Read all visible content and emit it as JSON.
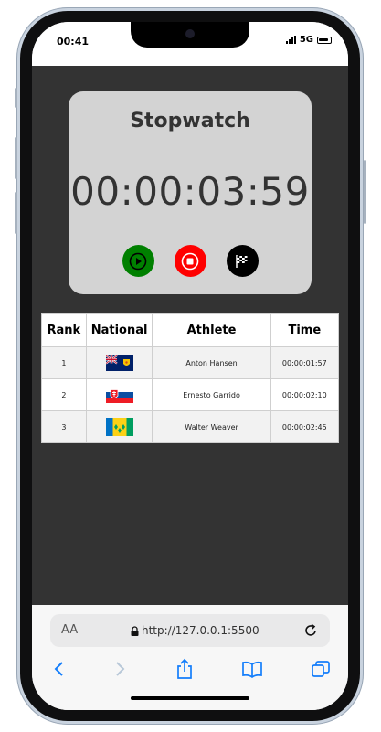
{
  "status_bar": {
    "time": "00:41",
    "network": "5G"
  },
  "stopwatch": {
    "title": "Stopwatch",
    "time": "00:00:03:59",
    "controls": [
      {
        "name": "start",
        "icon": "play-icon",
        "color": "#008000"
      },
      {
        "name": "stop",
        "icon": "stop-icon",
        "color": "#ff0000"
      },
      {
        "name": "lap",
        "icon": "checkered-flag-icon",
        "color": "#000000"
      }
    ]
  },
  "table": {
    "headers": {
      "rank": "Rank",
      "national": "National",
      "athlete": "Athlete",
      "time": "Time"
    },
    "rows": [
      {
        "rank": "1",
        "flag": "flag-turks-and-caicos-icon",
        "athlete": "Anton Hansen",
        "time": "00:00:01:57"
      },
      {
        "rank": "2",
        "flag": "flag-slovakia-icon",
        "athlete": "Ernesto Garrido",
        "time": "00:00:02:10"
      },
      {
        "rank": "3",
        "flag": "flag-saint-vincent-icon",
        "athlete": "Walter Weaver",
        "time": "00:00:02:45"
      }
    ]
  },
  "browser": {
    "text_size_label": "AA",
    "url": "http://127.0.0.1:5500",
    "nav": [
      "back-icon",
      "forward-icon",
      "share-icon",
      "bookmarks-icon",
      "tabs-icon"
    ]
  }
}
